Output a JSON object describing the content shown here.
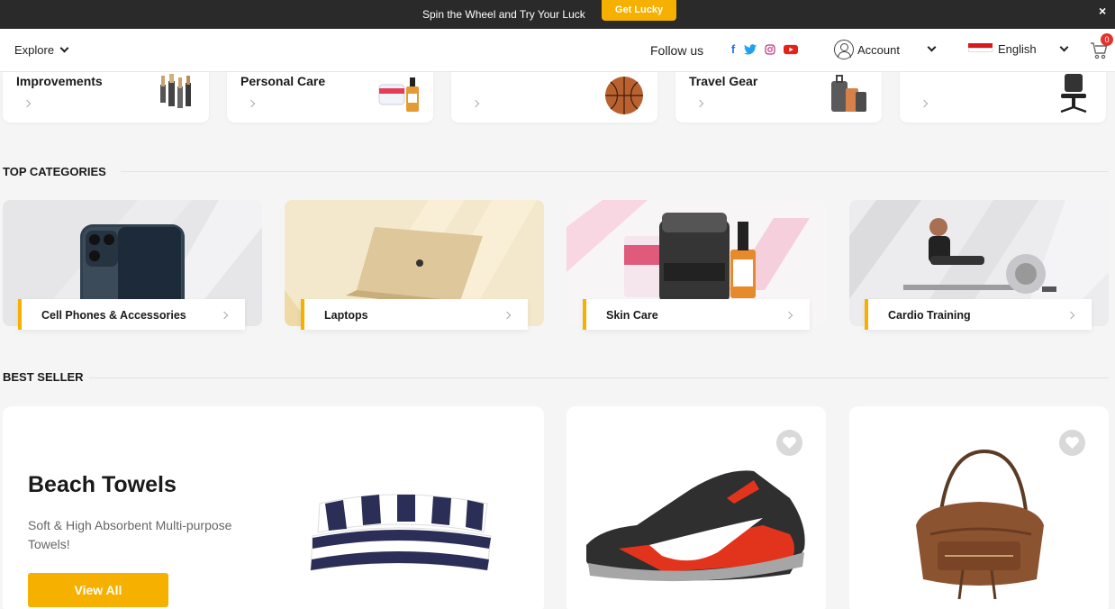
{
  "promo_bar": {
    "text": "Spin the Wheel and Try Your Luck",
    "button": "Get Lucky",
    "close": "×"
  },
  "header": {
    "explore": "Explore",
    "follow_us": "Follow us",
    "social_icons": [
      "facebook-icon",
      "twitter-icon",
      "instagram-icon",
      "youtube-icon"
    ],
    "account": "Account",
    "language": "English",
    "cart_count": "0"
  },
  "mini_categories": [
    {
      "title": "Improvements",
      "icon": "paint-brushes-icon"
    },
    {
      "title": "Personal Care",
      "icon": "skincare-products-icon"
    },
    {
      "title": "",
      "icon": "basketball-icon"
    },
    {
      "title": "Travel Gear",
      "icon": "luggage-icon"
    },
    {
      "title": "",
      "icon": "office-chair-icon"
    }
  ],
  "top_categories": {
    "heading": "TOP CATEGORIES",
    "items": [
      {
        "label": "Cell Phones & Accessories",
        "icon": "phone-icon"
      },
      {
        "label": "Laptops",
        "icon": "laptop-icon"
      },
      {
        "label": "Skin Care",
        "icon": "skin-care-icon"
      },
      {
        "label": "Cardio Training",
        "icon": "rowing-machine-icon"
      }
    ]
  },
  "best_seller": {
    "heading": "BEST SELLER",
    "promo": {
      "title": "Beach Towels",
      "subtitle": "Soft & High Absorbent Multi-purpose Towels!",
      "button": "View All"
    },
    "products": [
      {
        "icon": "sneaker-icon"
      },
      {
        "icon": "handbag-icon"
      }
    ]
  },
  "colors": {
    "accent": "#f6b100",
    "promo_bg": "#2a2a2a",
    "page_bg": "#f4f5f4",
    "badge": "#e5322d"
  }
}
